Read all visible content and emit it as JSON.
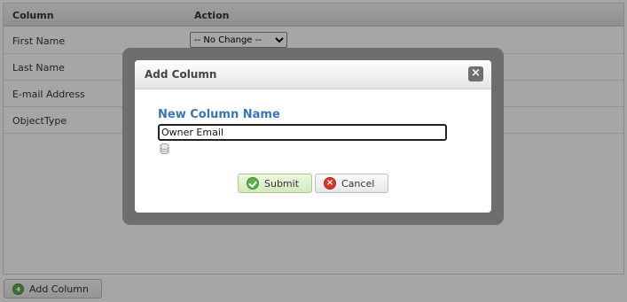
{
  "grid": {
    "headers": {
      "column": "Column",
      "action": "Action"
    },
    "rows": [
      {
        "name": "First Name",
        "action": "-- No Change --"
      },
      {
        "name": "Last Name",
        "action": ""
      },
      {
        "name": "E-mail Address",
        "action": ""
      },
      {
        "name": "ObjectType",
        "action": ""
      }
    ]
  },
  "footer": {
    "add_column_label": "Add Column"
  },
  "dialog": {
    "title": "Add Column",
    "close_symbol": "×",
    "field_label": "New Column Name",
    "field_value": "Owner Email",
    "submit_label": "Submit",
    "cancel_label": "Cancel"
  },
  "colors": {
    "field_label": "#3a76b0",
    "submit_bg": "#d2e8bd",
    "cancel_icon": "#d93a2f",
    "submit_icon": "#5bb04a"
  },
  "icons": [
    "plus-circle-icon",
    "database-icon",
    "check-circle-icon",
    "x-circle-icon",
    "close-icon",
    "dropdown-arrow-icon"
  ]
}
